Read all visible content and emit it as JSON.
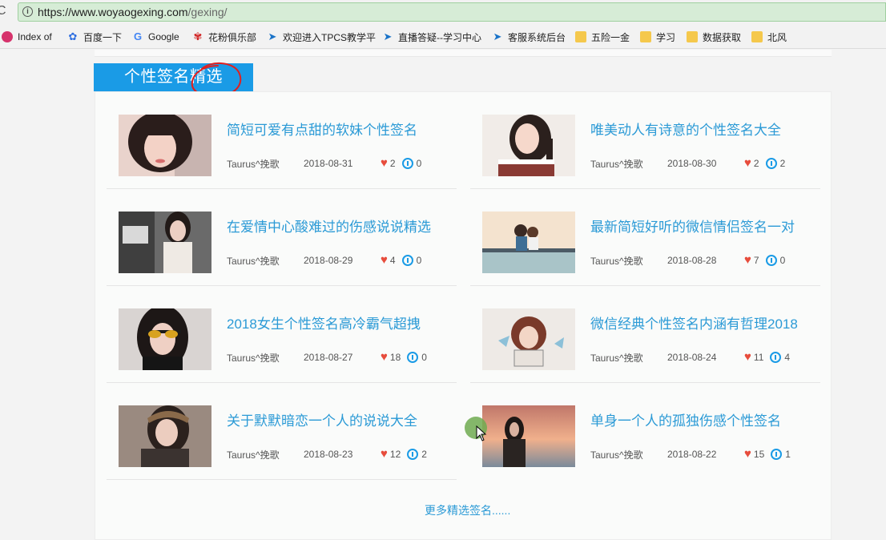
{
  "browser": {
    "url_host": "https://www.woyaogexing.com",
    "url_path": "/gexing/",
    "bookmarks": [
      {
        "label": "Index of",
        "icon": "index-of-icon"
      },
      {
        "label": "百度一下",
        "icon": "baidu-icon"
      },
      {
        "label": "Google",
        "icon": "google-icon"
      },
      {
        "label": "花粉俱乐部",
        "icon": "huawei-icon"
      },
      {
        "label": "欢迎进入TPCS教学平",
        "icon": "tpcs-icon"
      },
      {
        "label": "直播答疑--学习中心",
        "icon": "tpcs-icon"
      },
      {
        "label": "客服系统后台",
        "icon": "tpcs-icon"
      },
      {
        "label": "五险一金",
        "icon": "folder-icon"
      },
      {
        "label": "学习",
        "icon": "folder-icon"
      },
      {
        "label": "数据获取",
        "icon": "folder-icon"
      },
      {
        "label": "北风",
        "icon": "folder-icon"
      }
    ]
  },
  "section": {
    "title": "个性签名精选",
    "more_link": "更多精选签名......"
  },
  "items": [
    {
      "title": "简短可爱有点甜的软妹个性签名",
      "author": "Taurus^挽歌",
      "date": "2018-08-31",
      "likes": "2",
      "comments": "0"
    },
    {
      "title": "唯美动人有诗意的个性签名大全",
      "author": "Taurus^挽歌",
      "date": "2018-08-30",
      "likes": "2",
      "comments": "2"
    },
    {
      "title": "在爱情中心酸难过的伤感说说精选",
      "author": "Taurus^挽歌",
      "date": "2018-08-29",
      "likes": "4",
      "comments": "0"
    },
    {
      "title": "最新简短好听的微信情侣签名一对",
      "author": "Taurus^挽歌",
      "date": "2018-08-28",
      "likes": "7",
      "comments": "0"
    },
    {
      "title": "2018女生个性签名高冷霸气超拽",
      "author": "Taurus^挽歌",
      "date": "2018-08-27",
      "likes": "18",
      "comments": "0"
    },
    {
      "title": "微信经典个性签名内涵有哲理2018",
      "author": "Taurus^挽歌",
      "date": "2018-08-24",
      "likes": "11",
      "comments": "4"
    },
    {
      "title": "关于默默暗恋一个人的说说大全",
      "author": "Taurus^挽歌",
      "date": "2018-08-23",
      "likes": "12",
      "comments": "2"
    },
    {
      "title": "单身一个人的孤独伤感个性签名",
      "author": "Taurus^挽歌",
      "date": "2018-08-22",
      "likes": "15",
      "comments": "1"
    }
  ],
  "colors": {
    "accent": "#1a9be6",
    "title_link": "#2b9ad6",
    "heart": "#e74c3c",
    "scribble": "#e02020"
  }
}
